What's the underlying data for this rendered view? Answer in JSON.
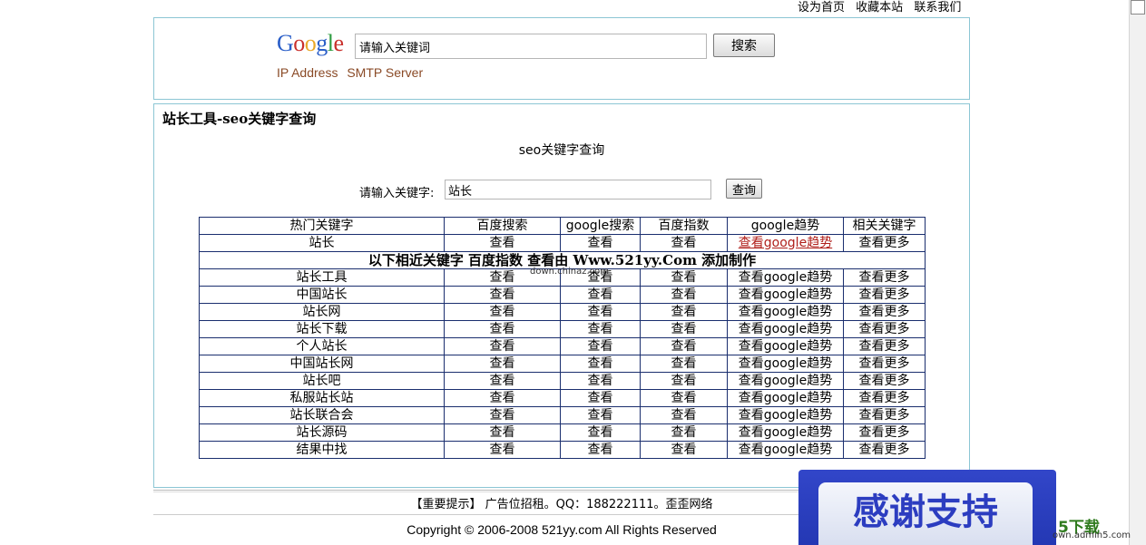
{
  "toplinks": [
    "设为首页",
    "收藏本站",
    "联系我们"
  ],
  "google": {
    "logo": "Google",
    "search_value": "请输入关键词",
    "search_button": "搜索",
    "links": [
      "IP Address",
      "SMTP Server"
    ]
  },
  "main": {
    "title": "站长工具-seo关键字查询",
    "subtitle": "seo关键字查询",
    "keyword_label": "请输入关键字:",
    "keyword_value": "站长",
    "query_button": "查询"
  },
  "table": {
    "headers": [
      "热门关键字",
      "百度搜索",
      "google搜索",
      "百度指数",
      "google趋势",
      "相关关键字"
    ],
    "first_row": [
      "站长",
      "查看",
      "查看",
      "查看",
      "查看google趋势",
      "查看更多"
    ],
    "separator": "以下相近关键字 百度指数 查看由 Www.521yy.Com 添加制作",
    "rows": [
      [
        "站长工具",
        "查看",
        "查看",
        "查看",
        "查看google趋势",
        "查看更多"
      ],
      [
        "中国站长",
        "查看",
        "查看",
        "查看",
        "查看google趋势",
        "查看更多"
      ],
      [
        "站长网",
        "查看",
        "查看",
        "查看",
        "查看google趋势",
        "查看更多"
      ],
      [
        "站长下载",
        "查看",
        "查看",
        "查看",
        "查看google趋势",
        "查看更多"
      ],
      [
        "个人站长",
        "查看",
        "查看",
        "查看",
        "查看google趋势",
        "查看更多"
      ],
      [
        "中国站长网",
        "查看",
        "查看",
        "查看",
        "查看google趋势",
        "查看更多"
      ],
      [
        "站长吧",
        "查看",
        "查看",
        "查看",
        "查看google趋势",
        "查看更多"
      ],
      [
        "私服站长站",
        "查看",
        "查看",
        "查看",
        "查看google趋势",
        "查看更多"
      ],
      [
        "站长联合会",
        "查看",
        "查看",
        "查看",
        "查看google趋势",
        "查看更多"
      ],
      [
        "站长源码",
        "查看",
        "查看",
        "查看",
        "查看google趋势",
        "查看更多"
      ],
      [
        "结果中找",
        "查看",
        "查看",
        "查看",
        "查看google趋势",
        "查看更多"
      ]
    ]
  },
  "watermark_small": "down.chinaz.com",
  "footer": {
    "notice": "【重要提示】 广告位招租。QQ：188222111。歪歪网络",
    "copyright": "Copyright © 2006-2008 521yy.com All Rights Reserved"
  },
  "overlay": {
    "thanks": "感谢支持",
    "logo_text": "5下载",
    "url": "own.admin5.com"
  },
  "colors": {
    "panel_border": "#8cc6d4",
    "table_border": "#1a2e6e",
    "trend_link": "#b0201c",
    "quicklink": "#8a4a26",
    "badge_blue": "#2c3dc0"
  }
}
